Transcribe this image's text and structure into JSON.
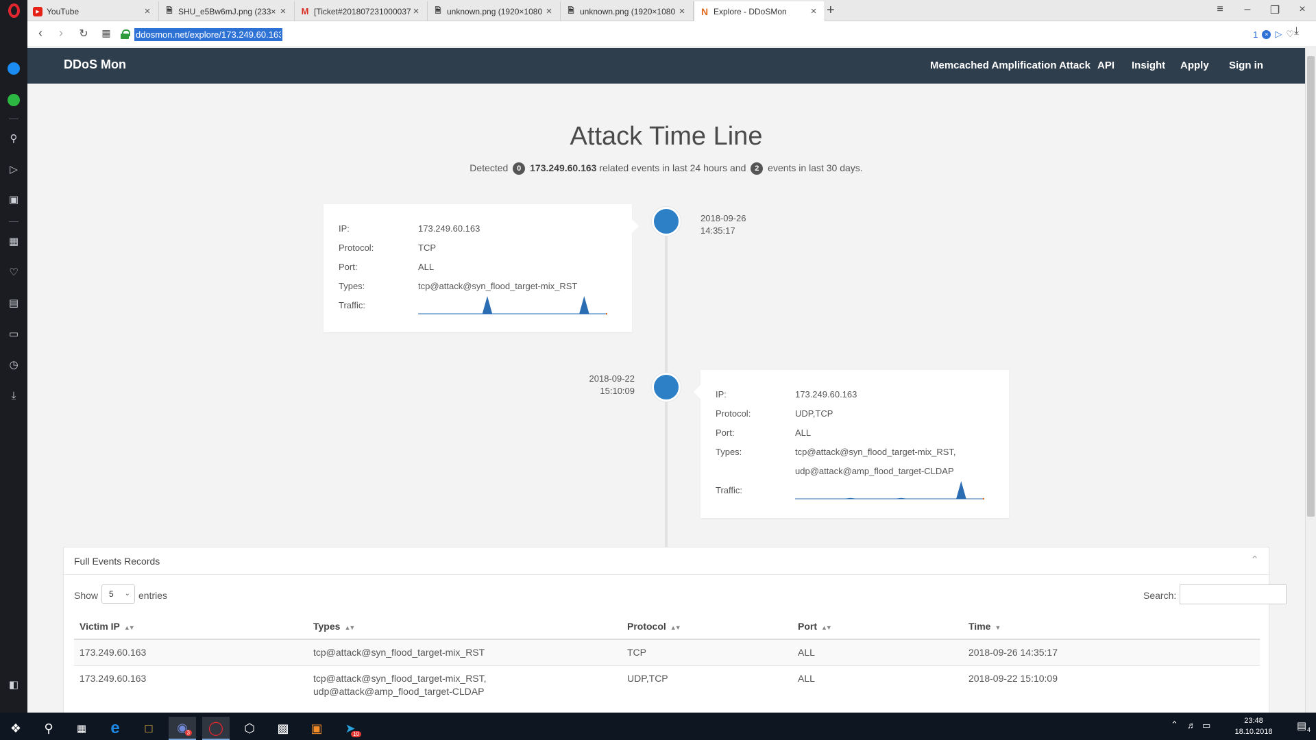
{
  "browser": {
    "tabs": [
      {
        "title": "YouTube",
        "favicon": "youtube-icon",
        "color": "#e62117"
      },
      {
        "title": "SHU_e5Bw6mJ.png (233×",
        "favicon": "file-icon"
      },
      {
        "title": "[Ticket#201807231000037",
        "favicon": "gmail-icon",
        "color": "#d93025"
      },
      {
        "title": "unknown.png (1920×1080",
        "favicon": "file-icon"
      },
      {
        "title": "unknown.png (1920×1080",
        "favicon": "file-icon"
      },
      {
        "title": "Explore - DDoSMon",
        "favicon": "ddosmon-icon",
        "color": "#e06a1c"
      }
    ],
    "url": "ddosmon.net/explore/173.249.60.163",
    "addr_badge": "1"
  },
  "site": {
    "brand": "DDoS Mon",
    "nav": [
      "Memcached Amplification Attack",
      "API",
      "Insight",
      "Apply",
      "Sign in"
    ]
  },
  "timeline": {
    "title": "Attack Time Line",
    "summary": {
      "prefix": "Detected",
      "count_24h": "0",
      "ip": "173.249.60.163",
      "middle": "related events in last 24 hours and",
      "count_30d": "2",
      "suffix": "events in last 30 days."
    },
    "labels": {
      "ip": "IP:",
      "protocol": "Protocol:",
      "port": "Port:",
      "types": "Types:",
      "traffic": "Traffic:"
    },
    "events": [
      {
        "date": "2018-09-26",
        "time": "14:35:17",
        "ip": "173.249.60.163",
        "protocol": "TCP",
        "port": "ALL",
        "types": [
          "tcp@attack@syn_flood_target-mix_RST"
        ],
        "traffic": [
          0,
          0,
          0,
          0,
          0,
          0,
          0,
          0,
          0,
          0,
          0,
          0,
          0,
          0,
          0,
          1,
          0,
          0,
          0,
          0,
          0,
          0,
          0,
          0,
          0,
          0,
          0,
          0,
          0,
          0,
          0,
          0,
          0,
          0,
          0,
          0,
          1,
          0,
          0,
          0,
          0,
          0
        ]
      },
      {
        "date": "2018-09-22",
        "time": "15:10:09",
        "ip": "173.249.60.163",
        "protocol": "UDP,TCP",
        "port": "ALL",
        "types": [
          "tcp@attack@syn_flood_target-mix_RST,",
          "udp@attack@amp_flood_target-CLDAP"
        ],
        "traffic": [
          0,
          0,
          0,
          0,
          0,
          0,
          0,
          0,
          0,
          0,
          0,
          0,
          0.03,
          0,
          0,
          0,
          0,
          0,
          0,
          0,
          0,
          0,
          0,
          0.03,
          0,
          0,
          0,
          0,
          0,
          0,
          0,
          0,
          0,
          0,
          0,
          0,
          1,
          0,
          0,
          0,
          0,
          0
        ]
      }
    ],
    "colors": {
      "dot": "#2d7fc6",
      "spark": "#2a6db3"
    }
  },
  "records": {
    "title": "Full Events Records",
    "show_label": "Show",
    "entries_value": "5",
    "entries_label": "entries",
    "search_label": "Search:",
    "columns": [
      "Victim IP",
      "Types",
      "Protocol",
      "Port",
      "Time"
    ],
    "rows": [
      {
        "ip": "173.249.60.163",
        "types": [
          "tcp@attack@syn_flood_target-mix_RST"
        ],
        "protocol": "TCP",
        "port": "ALL",
        "time": "2018-09-26 14:35:17"
      },
      {
        "ip": "173.249.60.163",
        "types": [
          "tcp@attack@syn_flood_target-mix_RST,",
          "udp@attack@amp_flood_target-CLDAP"
        ],
        "protocol": "UDP,TCP",
        "port": "ALL",
        "time": "2018-09-22 15:10:09"
      }
    ]
  },
  "taskbar": {
    "time": "23:48",
    "date": "18.10.2018",
    "notif_count": "4",
    "discord_badge": "3",
    "telegram_badge": "10"
  }
}
